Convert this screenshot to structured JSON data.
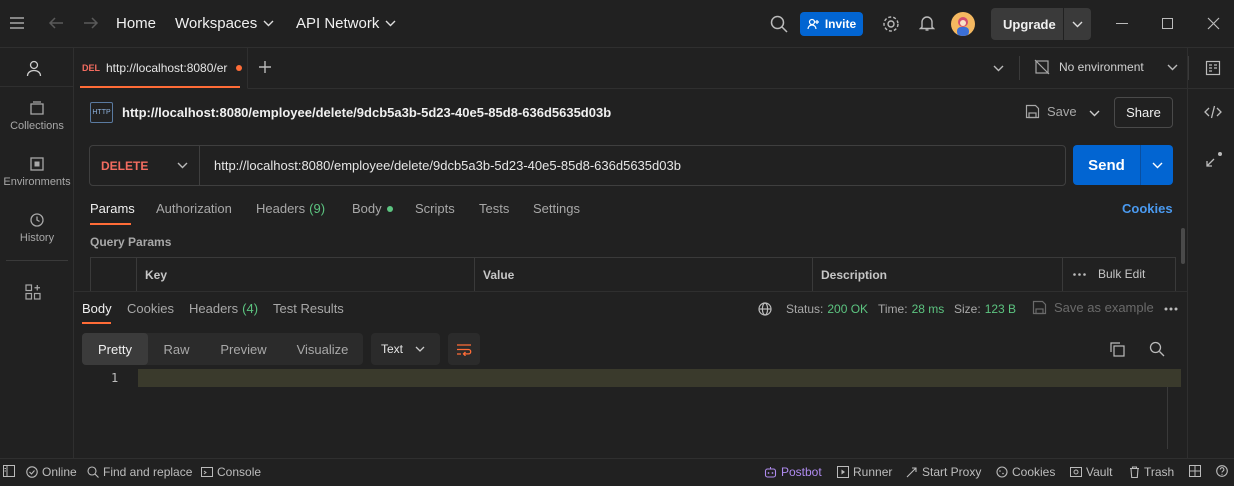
{
  "topbar": {
    "home": "Home",
    "workspaces": "Workspaces",
    "api_network": "API Network",
    "invite": "Invite",
    "upgrade": "Upgrade"
  },
  "sidebar": {
    "items": [
      {
        "label": "Collections"
      },
      {
        "label": "Environments"
      },
      {
        "label": "History"
      }
    ]
  },
  "tab": {
    "method": "DEL",
    "title": "http://localhost:8080/er",
    "environment": "No environment"
  },
  "request": {
    "icon_label": "HTTP",
    "name": "http://localhost:8080/employee/delete/9dcb5a3b-5d23-40e5-85d8-636d5635d03b",
    "save": "Save",
    "share": "Share",
    "method": "DELETE",
    "url": "http://localhost:8080/employee/delete/9dcb5a3b-5d23-40e5-85d8-636d5635d03b",
    "send": "Send"
  },
  "req_tabs": {
    "params": "Params",
    "authorization": "Authorization",
    "headers": "Headers",
    "headers_count": "(9)",
    "body": "Body",
    "scripts": "Scripts",
    "tests": "Tests",
    "settings": "Settings",
    "cookies": "Cookies"
  },
  "query_params": {
    "title": "Query Params",
    "columns": [
      "Key",
      "Value",
      "Description"
    ],
    "bulk_edit": "Bulk Edit"
  },
  "response": {
    "tabs": {
      "body": "Body",
      "cookies": "Cookies",
      "headers": "Headers",
      "headers_count": "(4)",
      "test_results": "Test Results"
    },
    "status_label": "Status:",
    "status_value": "200 OK",
    "time_label": "Time:",
    "time_value": "28 ms",
    "size_label": "Size:",
    "size_value": "123 B",
    "save_example": "Save as example",
    "views": [
      "Pretty",
      "Raw",
      "Preview",
      "Visualize"
    ],
    "format": "Text",
    "line_number": "1"
  },
  "statusbar": {
    "online": "Online",
    "find_replace": "Find and replace",
    "console": "Console",
    "postbot": "Postbot",
    "runner": "Runner",
    "start_proxy": "Start Proxy",
    "cookies": "Cookies",
    "vault": "Vault",
    "trash": "Trash"
  },
  "colors": {
    "accent_blue": "#0265d2",
    "method_red": "#f36c60",
    "status_green": "#5cc480",
    "postbot_purple": "#b08cf0",
    "tab_underline": "#ff6c37"
  }
}
